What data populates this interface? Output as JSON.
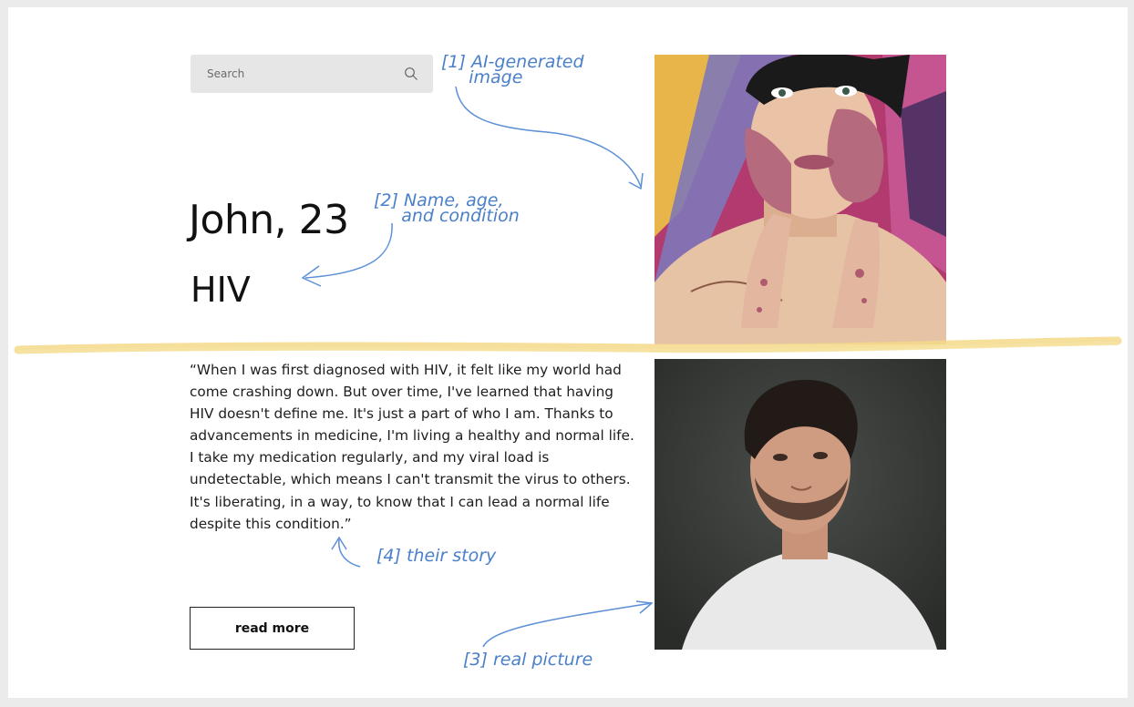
{
  "search": {
    "placeholder": "Search"
  },
  "profile": {
    "name_age": "John, 23",
    "condition": "HIV",
    "story": "“When I was first diagnosed with HIV, it felt like my world had come crashing down. But over time, I've learned that having HIV doesn't define me. It's just a part of who I am. Thanks to advancements in medicine, I'm living a healthy and normal life. I take my medication regularly, and my viral load is undetectable, which means I can't transmit the virus to others. It's liberating, in a way, to know that I can lead a normal life despite this condition.”",
    "read_more_label": "read more"
  },
  "annotations": {
    "ai_image": "[1] AI-generated\n     image",
    "name_age_condition": "[2] Name, age,\n     and condition",
    "real_picture": "[3] real picture",
    "their_story": "[4] their story"
  },
  "colors": {
    "annotation": "#4a7fc9",
    "highlight": "#f3d98a",
    "search_bg": "#e6e6e6"
  },
  "icons": {
    "search": "search-icon"
  }
}
